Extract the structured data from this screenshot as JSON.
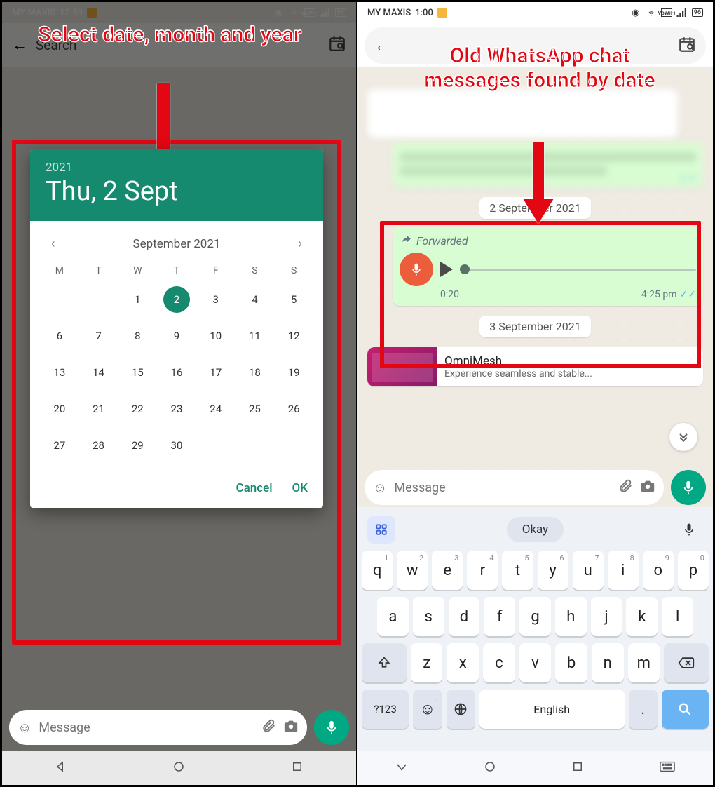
{
  "left": {
    "status": {
      "carrier": "MY MAXIS",
      "time": "12:59",
      "battery": "96"
    },
    "search": {
      "placeholder": "Search"
    },
    "callout": "Select date, month and year",
    "datepicker": {
      "year": "2021",
      "date_label": "Thu, 2 Sept",
      "month_label": "September 2021",
      "dow": [
        "M",
        "T",
        "W",
        "T",
        "F",
        "S",
        "S"
      ],
      "days": [
        "",
        "",
        "1",
        "2",
        "3",
        "4",
        "5",
        "6",
        "7",
        "8",
        "9",
        "10",
        "11",
        "12",
        "13",
        "14",
        "15",
        "16",
        "17",
        "18",
        "19",
        "20",
        "21",
        "22",
        "23",
        "24",
        "25",
        "26",
        "27",
        "28",
        "29",
        "30",
        "",
        ""
      ],
      "selected": "2",
      "cancel": "Cancel",
      "ok": "OK"
    },
    "compose": {
      "placeholder": "Message"
    }
  },
  "right": {
    "status": {
      "carrier": "MY MAXIS",
      "time": "1:00",
      "battery": "96"
    },
    "callout": "Old WhatsApp chat messages found by date",
    "date1": "2 September 2021",
    "voice": {
      "forwarded": "Forwarded",
      "duration": "0:20",
      "time": "4:25 pm"
    },
    "date2": "3 September 2021",
    "ad": {
      "title": "OmniMesh",
      "sub": "Experience seamless and stable..."
    },
    "compose": {
      "placeholder": "Message"
    },
    "keyboard": {
      "suggestion": "Okay",
      "row1": [
        [
          "q",
          "1"
        ],
        [
          "w",
          "2"
        ],
        [
          "e",
          "3"
        ],
        [
          "r",
          "4"
        ],
        [
          "t",
          "5"
        ],
        [
          "y",
          "6"
        ],
        [
          "u",
          "7"
        ],
        [
          "i",
          "8"
        ],
        [
          "o",
          "9"
        ],
        [
          "p",
          "0"
        ]
      ],
      "row2": [
        "a",
        "s",
        "d",
        "f",
        "g",
        "h",
        "j",
        "k",
        "l"
      ],
      "row3": [
        "z",
        "x",
        "c",
        "v",
        "b",
        "n",
        "m"
      ],
      "sym": "?123",
      "space": "English",
      "comma": ",",
      "period": "."
    }
  }
}
